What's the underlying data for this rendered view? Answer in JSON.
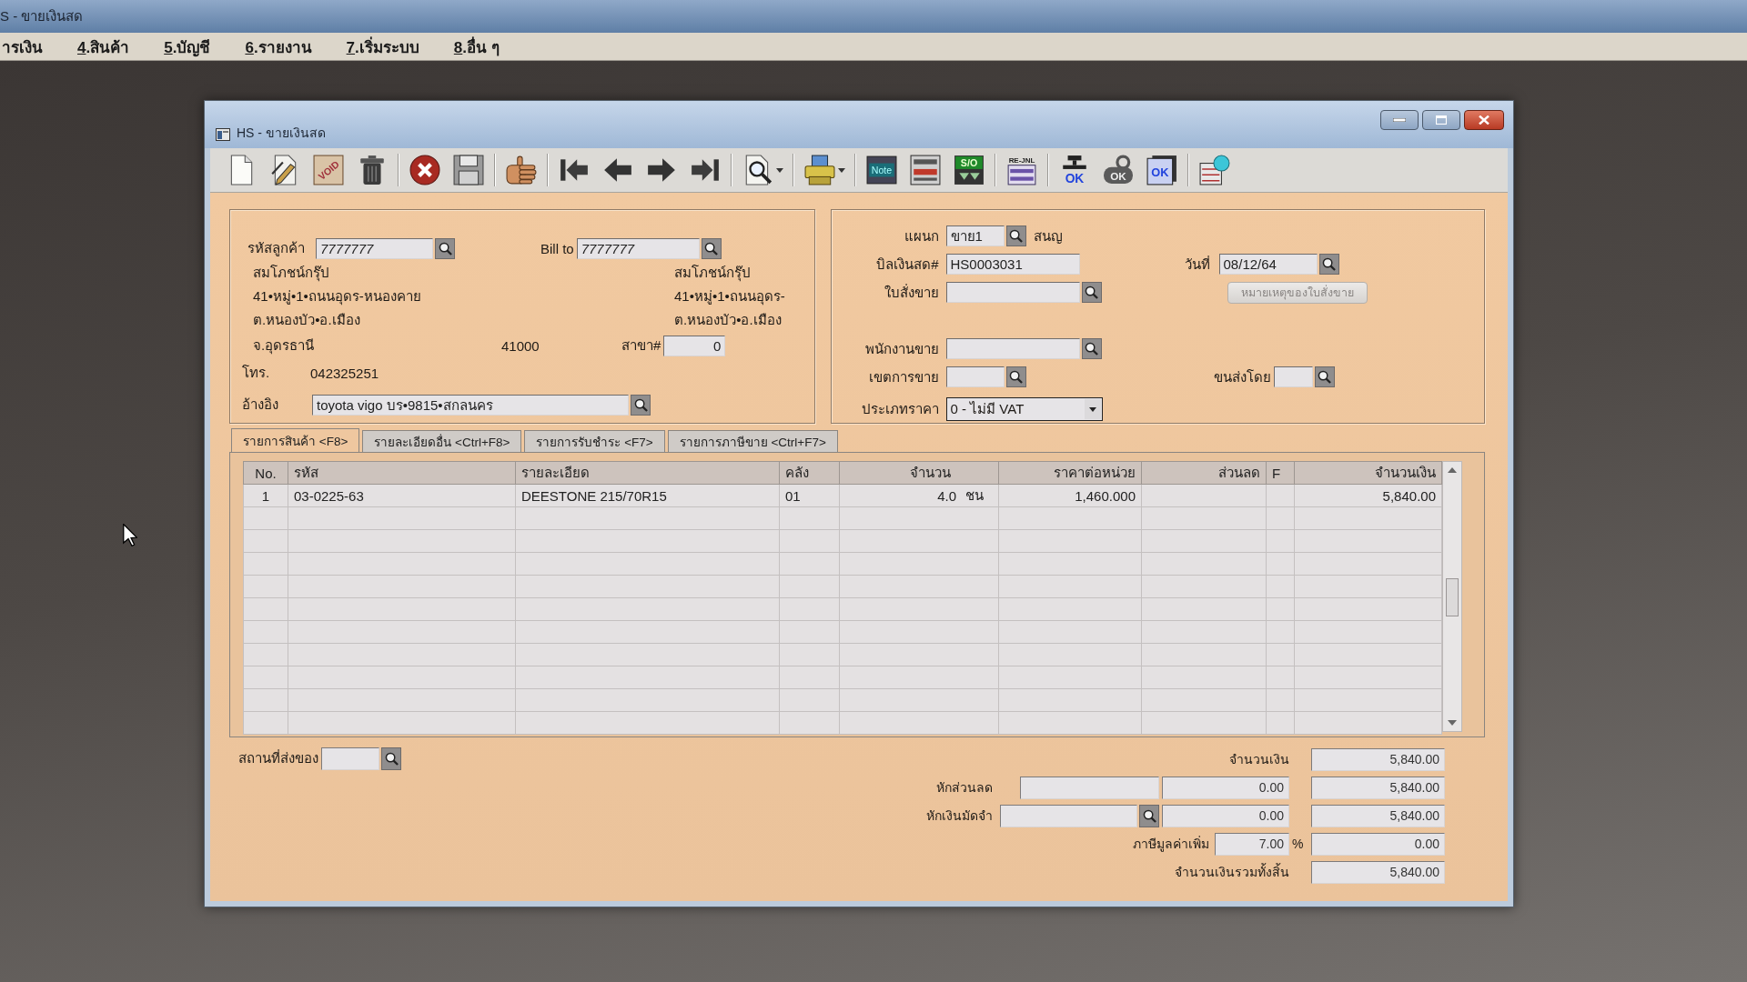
{
  "main_window": {
    "title": "S - ขายเงินสด"
  },
  "menu": [
    {
      "label": "ารเงิน",
      "mnemonic": false
    },
    {
      "label": "4.สินค้า",
      "mnemonic": true
    },
    {
      "label": "5.บัญชี",
      "mnemonic": true
    },
    {
      "label": "6.รายงาน",
      "mnemonic": true
    },
    {
      "label": "7.เริ่มระบบ",
      "mnemonic": true
    },
    {
      "label": "8.อื่น ๆ",
      "mnemonic": true
    }
  ],
  "window": {
    "title": "HS - ขายเงินสด"
  },
  "toolbar": [
    {
      "kind": "new",
      "dropdown": false
    },
    {
      "kind": "edit",
      "dropdown": false
    },
    {
      "kind": "void",
      "text": "VOID",
      "dropdown": false
    },
    {
      "kind": "delete",
      "dropdown": false
    },
    {
      "kind": "separator"
    },
    {
      "kind": "cancel",
      "dropdown": false
    },
    {
      "kind": "save",
      "dropdown": false
    },
    {
      "kind": "separator"
    },
    {
      "kind": "hand",
      "dropdown": false
    },
    {
      "kind": "separator"
    },
    {
      "kind": "first",
      "dropdown": false
    },
    {
      "kind": "previous",
      "dropdown": false
    },
    {
      "kind": "next",
      "dropdown": false
    },
    {
      "kind": "last",
      "dropdown": false
    },
    {
      "kind": "separator"
    },
    {
      "kind": "find",
      "dropdown": true
    },
    {
      "kind": "separator"
    },
    {
      "kind": "print",
      "dropdown": true
    },
    {
      "kind": "separator"
    },
    {
      "kind": "note",
      "text": "Note",
      "dropdown": false
    },
    {
      "kind": "form",
      "dropdown": false
    },
    {
      "kind": "so",
      "text": "S/O",
      "dropdown": false
    },
    {
      "kind": "separator"
    },
    {
      "kind": "journal",
      "text": "RE-JNL",
      "dropdown": false
    },
    {
      "kind": "separator"
    },
    {
      "kind": "approve",
      "text": "OK",
      "dropdown": false
    },
    {
      "kind": "link_approve",
      "text": "OK",
      "dropdown": false
    },
    {
      "kind": "doc_approve",
      "text": "OK",
      "dropdown": false
    },
    {
      "kind": "separator"
    },
    {
      "kind": "transfer",
      "dropdown": false
    }
  ],
  "customer": {
    "code_label": "รหัสลูกค้า",
    "code": "7777777",
    "name": "สมโภชน์กรุ๊ป",
    "address_1": "41•หมู่•1•ถนนอุดร-หนองคาย",
    "address_2": "ต.หนองบัว•อ.เมือง",
    "province": "จ.อุดรธานี",
    "postcode": "41000",
    "phone_label": "โทร.",
    "phone": "042325251",
    "reference_label": "อ้างอิง",
    "reference": "toyota vigo บร•9815•สกลนคร"
  },
  "bill_to": {
    "label": "Bill to",
    "code": "7777777",
    "name": "สมโภชน์กรุ๊ป",
    "address_1": "41•หมู่•1•ถนนอุดร-",
    "address_2": "ต.หนองบัว•อ.เมือง",
    "branch_label": "สาขา#",
    "branch": "0"
  },
  "document": {
    "department_label": "แผนก",
    "department": "ขาย1",
    "department_name": "สนญ",
    "bill_no_label": "บิลเงินสด#",
    "bill_no": "HS0003031",
    "date_label": "วันที่",
    "date": "08/12/64",
    "sales_order_label": "ใบสั่งขาย",
    "sales_order_note": {
      "label": "หมายเหตุของใบสั่งขาย",
      "disabled": true
    },
    "salesperson_label": "พนักงานขาย",
    "sales_area_label": "เขตการขาย",
    "shipping_label": "ขนส่งโดย",
    "price_type_label": "ประเภทราคา",
    "price_type": "0 - ไม่มี VAT"
  },
  "tabs": [
    {
      "label": "รายการสินค้า <F8>",
      "selected": true
    },
    {
      "label": "รายละเอียดอื่น <Ctrl+F8>",
      "selected": false
    },
    {
      "label": "รายการรับชำระ <F7>",
      "selected": false
    },
    {
      "label": "รายการภาษีขาย <Ctrl+F7>",
      "selected": false
    }
  ],
  "table": {
    "columns": [
      "No.",
      "รหัส",
      "รายละเอียด",
      "คลัง",
      "จำนวน",
      "ราคาต่อหน่วย",
      "ส่วนลด",
      "F",
      "จำนวนเงิน"
    ],
    "rows": [
      {
        "no": "1",
        "code": "03-0225-63",
        "description": "DEESTONE 215/70R15",
        "warehouse": "01",
        "quantity": "4.0",
        "unit": "ชน",
        "unit_price": "1,460.000",
        "amount": "5,840.00"
      }
    ]
  },
  "delivery": {
    "label": "สถานที่ส่งของ"
  },
  "totals": {
    "subtotal_label": "จำนวนเงิน",
    "subtotal": "5,840.00",
    "discount_label": "หักส่วนลด",
    "discount": "0.00",
    "after_discount": "5,840.00",
    "deposit_label": "หักเงินมัดจำ",
    "deposit": "0.00",
    "after_deposit": "5,840.00",
    "vat_label": "ภาษีมูลค่าเพิ่ม",
    "vat_rate": "7.00",
    "vat_unit": "%",
    "vat": "0.00",
    "total_label": "จำนวนเงินรวมทั้งสิ้น",
    "total": "5,840.00"
  }
}
